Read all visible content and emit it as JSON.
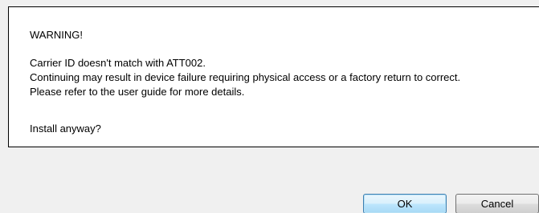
{
  "message": {
    "title": "WARNING!",
    "line1": "Carrier ID doesn't match with ATT002.",
    "line2": "Continuing may result in device failure requiring physical access or a factory return to correct.",
    "line3": "Please refer to the user guide for more details.",
    "question": "Install anyway?"
  },
  "buttons": {
    "ok_label": "OK",
    "cancel_label": "Cancel"
  },
  "colors": {
    "dialog_background": "#f0f0f0",
    "message_background": "#ffffff",
    "default_button_border": "#3c7fb1"
  }
}
